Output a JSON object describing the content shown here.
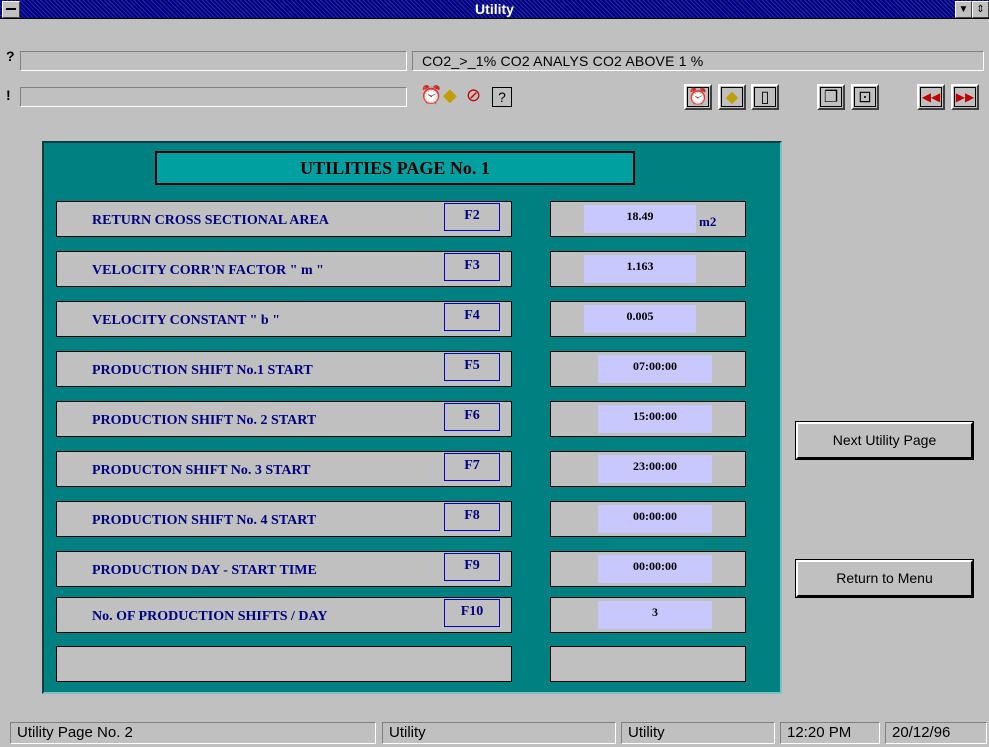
{
  "window": {
    "title": "Utility"
  },
  "alarm": {
    "help_mark": "?",
    "exclaim_mark": "!",
    "message": "CO2_>_1%  CO2 ANALYS CO2 ABOVE 1 %"
  },
  "toolbar_icons": [
    "alarm-clock-icon",
    "warning-diamond-icon",
    "no-alarm-icon",
    "help-pointer-icon",
    "alarm-clock-icon",
    "warning-diamond-icon",
    "document-icon",
    "copy-pages-icon",
    "export-icon",
    "rewind-icon",
    "fast-forward-icon"
  ],
  "page": {
    "title": "UTILITIES PAGE No. 1"
  },
  "rows": [
    {
      "label": "RETURN CROSS SECTIONAL AREA",
      "fkey": "F2",
      "value": "18.49",
      "unit": "m2"
    },
    {
      "label": "VELOCITY CORR'N FACTOR  \" m \"",
      "fkey": "F3",
      "value": "1.163",
      "unit": ""
    },
    {
      "label": "VELOCITY CONSTANT   \" b \"",
      "fkey": "F4",
      "value": "0.005",
      "unit": ""
    },
    {
      "label": "PRODUCTION SHIFT No.1 START",
      "fkey": "F5",
      "value": "07:00:00",
      "unit": ""
    },
    {
      "label": "PRODUCTION SHIFT No. 2  START",
      "fkey": "F6",
      "value": "15:00:00",
      "unit": ""
    },
    {
      "label": "PRODUCTON  SHIFT No. 3  START",
      "fkey": "F7",
      "value": "23:00:00",
      "unit": ""
    },
    {
      "label": "PRODUCTION SHIFT No. 4  START",
      "fkey": "F8",
      "value": "00:00:00",
      "unit": ""
    },
    {
      "label": "PRODUCTION DAY  - START TIME",
      "fkey": "F9",
      "value": "00:00:00",
      "unit": ""
    },
    {
      "label": "No. OF PRODUCTION SHIFTS  / DAY",
      "fkey": "F10",
      "value": "3",
      "unit": ""
    }
  ],
  "buttons": {
    "next": "Next Utility Page",
    "return": "Return to Menu"
  },
  "status": {
    "left": "Utility Page No. 2",
    "mid1": "Utility",
    "mid2": "Utility",
    "time": "12:20 PM",
    "date": "20/12/96"
  }
}
